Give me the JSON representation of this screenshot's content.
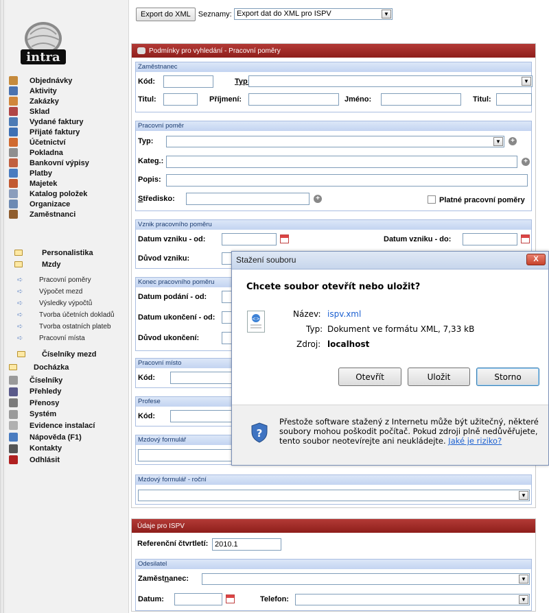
{
  "toolbar": {
    "export_button": "Export do XML",
    "lists_label": "Seznamy:",
    "lists_value": "Export dat do XML pro ISPV"
  },
  "nav": {
    "items": [
      {
        "label": "Objednávky",
        "icon": "clipboard-icon",
        "color": "#c58a3c"
      },
      {
        "label": "Aktivity",
        "icon": "calendar-icon",
        "color": "#4a72b0"
      },
      {
        "label": "Zakázky",
        "icon": "box-icon",
        "color": "#d0863b"
      },
      {
        "label": "Sklad",
        "icon": "warehouse-icon",
        "color": "#b04646"
      },
      {
        "label": "Vydané faktury",
        "icon": "invoice-out-icon",
        "color": "#4d7bb5"
      },
      {
        "label": "Přijaté faktury",
        "icon": "invoice-in-icon",
        "color": "#3e70b4"
      },
      {
        "label": "Účetnictví",
        "icon": "accounting-icon",
        "color": "#d06a2f"
      },
      {
        "label": "Pokladna",
        "icon": "cash-register-icon",
        "color": "#8f8f8f"
      },
      {
        "label": "Bankovní výpisy",
        "icon": "bank-statement-icon",
        "color": "#c06040"
      },
      {
        "label": "Platby",
        "icon": "payment-icon",
        "color": "#4a7cc0"
      },
      {
        "label": "Majetek",
        "icon": "house-icon",
        "color": "#c25a31"
      },
      {
        "label": "Katalog položek",
        "icon": "catalog-icon",
        "color": "#8a9dbc"
      },
      {
        "label": "Organizace",
        "icon": "book-icon",
        "color": "#6d8ab3"
      },
      {
        "label": "Zaměstnanci",
        "icon": "people-icon",
        "color": "#8f5d2e"
      }
    ],
    "sub_folders": [
      "Personalistika",
      "Mzdy"
    ],
    "mzdy_items": [
      "Pracovní poměry",
      "Výpočet mezd",
      "Výsledky výpočtů",
      "Tvorba účetních dokladů",
      "Tvorba ostatních plateb",
      "Pracovní místa"
    ],
    "ciselniky_mezd": "Číselníky mezd",
    "dochazka": "Docházka",
    "bottom_items": [
      {
        "label": "Číselníky",
        "icon": "gears-icon",
        "color": "#9a9a9a"
      },
      {
        "label": "Přehledy",
        "icon": "printer-icon",
        "color": "#5a5a8a"
      },
      {
        "label": "Přenosy",
        "icon": "transfer-icon",
        "color": "#7b7b7b"
      },
      {
        "label": "Systém",
        "icon": "tools-icon",
        "color": "#9a9a9a"
      },
      {
        "label": "Evidence instalací",
        "icon": "install-icon",
        "color": "#b0b0b0"
      },
      {
        "label": "Nápověda (F1)",
        "icon": "help-icon",
        "color": "#4a7cc0"
      },
      {
        "label": "Kontakty",
        "icon": "contacts-icon",
        "color": "#555555"
      },
      {
        "label": "Odhlásit",
        "icon": "logout-icon",
        "color": "#b02020"
      }
    ]
  },
  "filter_panel": {
    "title": "Podmínky pro vyhledání - Pracovní poměry",
    "zamestnanec": {
      "head": "Zaměstnanec",
      "kod": "Kód:",
      "typ": "Typ:",
      "titul": "Titul:",
      "prijmeni": "Příjmení:",
      "jmeno": "Jméno:",
      "titul2": "Titul:"
    },
    "pracovni_pomer": {
      "head": "Pracovní poměr",
      "typ": "Typ:",
      "kateg": "Kateg.:",
      "popis": "Popis:",
      "stredisko_s": "S",
      "stredisko_rest": "tředisko:",
      "platne": "Platné pracovní poměry"
    },
    "vznik": {
      "head": "Vznik pracovního poměru",
      "od": "Datum vzniku - od:",
      "do": "Datum vzniku - do:",
      "duvod": "Důvod vzniku:"
    },
    "konec": {
      "head": "Konec pracovního poměru",
      "podani": "Datum podání - od:",
      "ukonceni": "Datum ukončení - od:",
      "duvod": "Důvod ukončení:"
    },
    "pracovni_misto": {
      "head": "Pracovní místo",
      "kod": "Kód:"
    },
    "profese": {
      "head": "Profese",
      "kod": "Kód:"
    },
    "mzdovy": {
      "head": "Mzdový formulář"
    },
    "mzdovy_rocni": {
      "head": "Mzdový formulář - roční"
    }
  },
  "ispv_panel": {
    "title": "Údaje pro ISPV",
    "ref_label": "Referenční čtvrtletí:",
    "ref_value": "2010.1",
    "odesilatel": {
      "head": "Odesilatel",
      "zam_a": "Zaměst",
      "zam_u": "n",
      "zam_b": "anec:",
      "datum": "Datum:",
      "telefon": "Telefon:"
    }
  },
  "dialog": {
    "title": "Stažení souboru",
    "close": "X",
    "question": "Chcete soubor otevřít nebo uložit?",
    "name_label": "Název:",
    "name_value": "ispv.xml",
    "type_label": "Typ:",
    "type_value": "Dokument ve formátu XML, 7,33 kB",
    "source_label": "Zdroj:",
    "source_value": "localhost",
    "open_btn": "Otevřít",
    "save_btn": "Uložit",
    "cancel_btn": "Storno",
    "warning_text": "Přestože software stažený z Internetu může být užitečný, některé soubory mohou poškodit počítač. Pokud zdroji plně nedůvěřujete, tento soubor neotevírejte ani neukládejte.",
    "warning_link": "Jaké je riziko?"
  },
  "colors": {
    "panel_red": "#9b2622",
    "section_blue": "#c3d4f1",
    "link_blue": "#1a5fd0"
  }
}
